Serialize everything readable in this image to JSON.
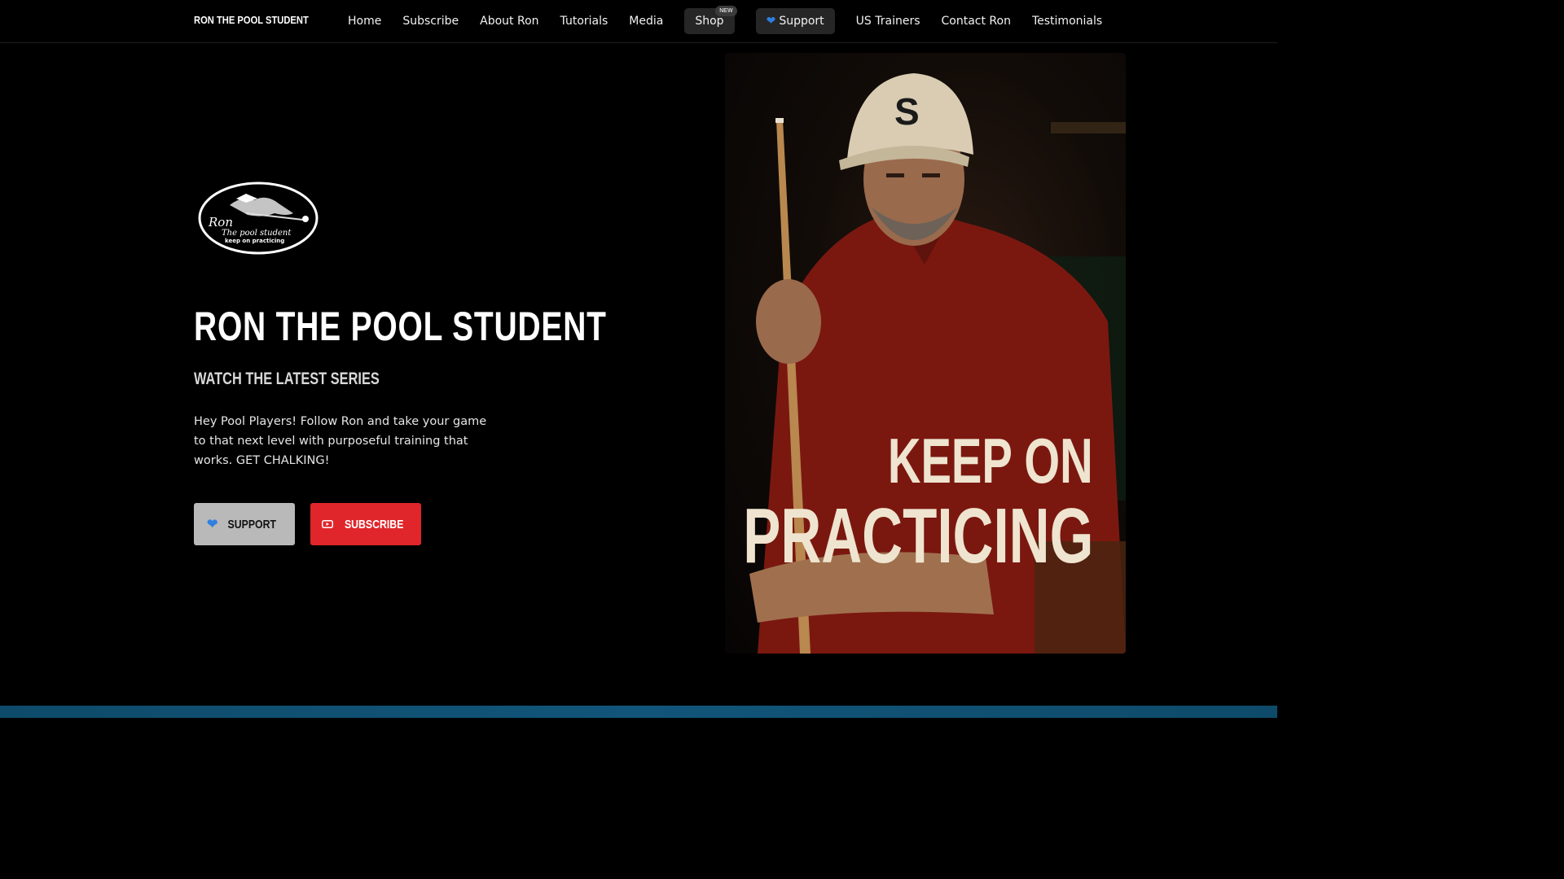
{
  "nav": {
    "brand": "RON THE POOL STUDENT",
    "items": [
      {
        "label": "Home"
      },
      {
        "label": "Subscribe"
      },
      {
        "label": "About Ron"
      },
      {
        "label": "Tutorials"
      },
      {
        "label": "Media"
      },
      {
        "label": "Shop",
        "badge": "NEW"
      },
      {
        "label": "Support",
        "icon": "blue-heart-icon"
      },
      {
        "label": "US Trainers"
      },
      {
        "label": "Contact Ron"
      },
      {
        "label": "Testimonials"
      }
    ]
  },
  "hero": {
    "logo": {
      "line1": "Ron",
      "line2": "The pool student",
      "line3": "keep on practicing"
    },
    "title": "RON THE POOL STUDENT",
    "subtitle": "WATCH THE LATEST SERIES",
    "description": "Hey Pool Players! Follow Ron and take your game to that next level with purposeful training that works. GET CHALKING!",
    "support_button": "SUPPORT",
    "subscribe_button": "SUBSCRIBE",
    "image_text_line1": "KEEP ON",
    "image_text_line2": "PRACTICING"
  },
  "colors": {
    "background": "#000000",
    "accent_red": "#e0262a",
    "support_grey": "#b9b9b9",
    "heart_blue": "#2f7fe0",
    "poster_text": "#efe4cf"
  }
}
